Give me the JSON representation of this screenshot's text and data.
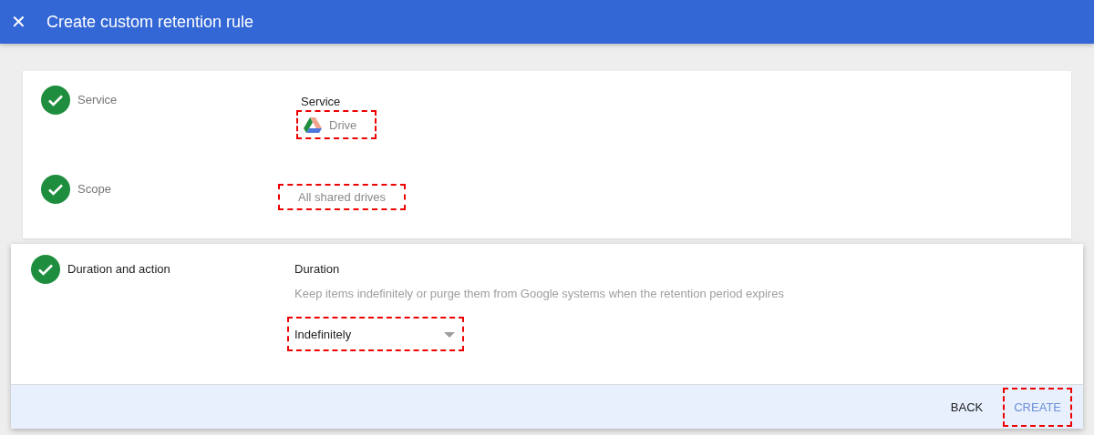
{
  "header": {
    "close_icon": "✕",
    "title": "Create custom retention rule"
  },
  "steps": [
    {
      "label": "Service",
      "done": true,
      "active": false,
      "field_label": "Service",
      "value": "Drive",
      "value_icon": true,
      "highlighted": true
    },
    {
      "label": "Scope",
      "done": true,
      "active": false,
      "value": "All shared drives",
      "value_icon": false,
      "highlighted": true
    }
  ],
  "active_step": {
    "label": "Duration and action",
    "done": true,
    "active": true,
    "field_label": "Duration",
    "hint": "Keep items indefinitely or purge them from Google systems when the retention period expires",
    "select": {
      "value": "Indefinitely",
      "highlighted": true
    }
  },
  "footer": {
    "buttons": [
      {
        "label": "BACK",
        "kind": "text",
        "highlighted": false
      },
      {
        "label": "CREATE",
        "kind": "primary",
        "highlighted": true
      }
    ]
  }
}
